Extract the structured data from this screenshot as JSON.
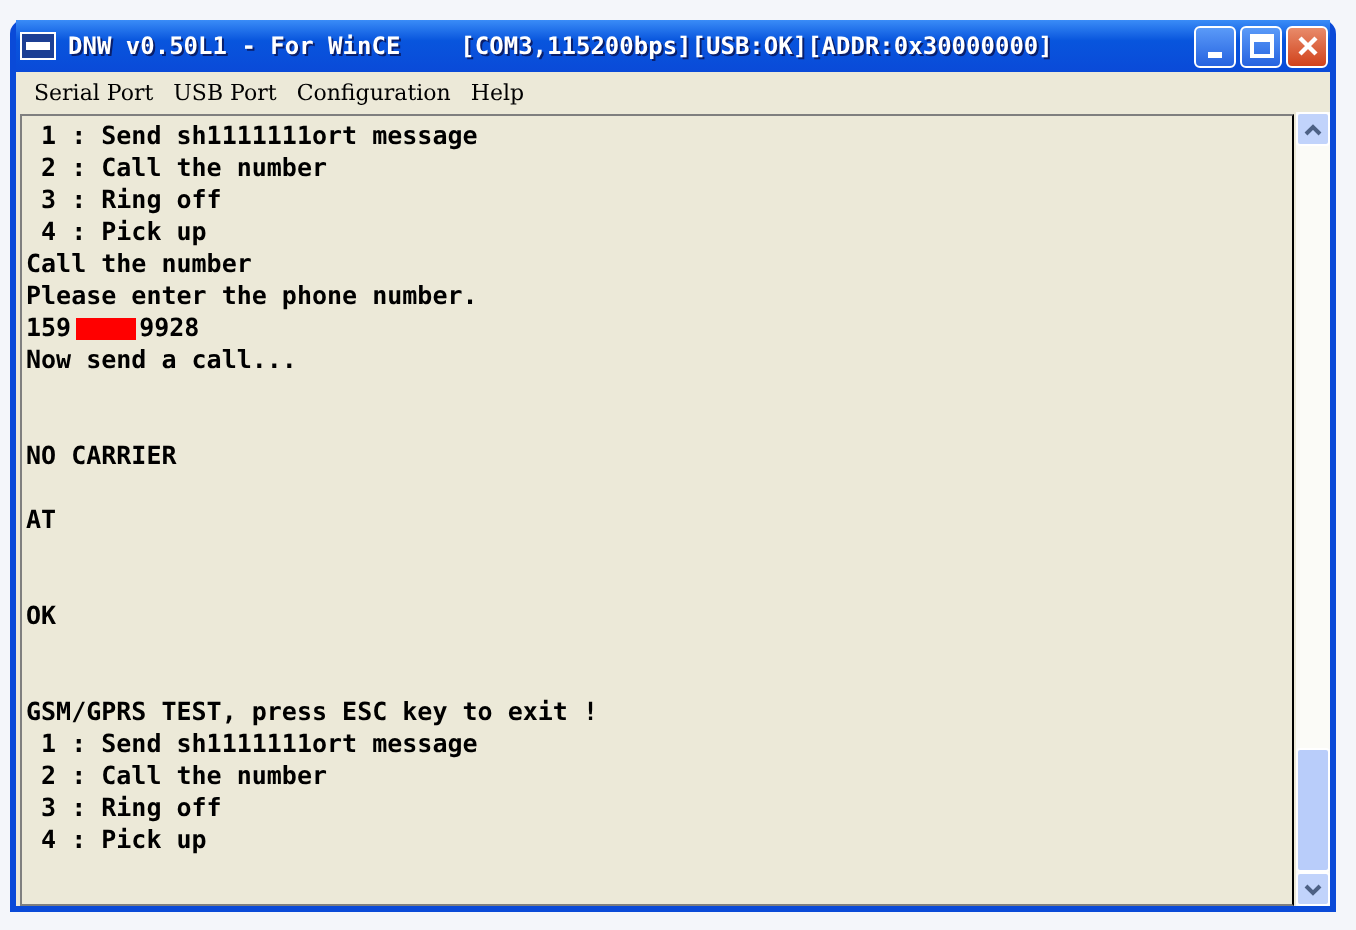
{
  "window": {
    "title": "DNW v0.50L1 - For WinCE",
    "status": "[COM3,115200bps][USB:OK][ADDR:0x30000000]"
  },
  "menu": [
    "Serial Port",
    "USB Port",
    "Configuration",
    "Help"
  ],
  "console": [
    {
      "kind": "text",
      "text": " 1 : Send sh1111111ort message"
    },
    {
      "kind": "text",
      "text": " 2 : Call the number"
    },
    {
      "kind": "text",
      "text": " 3 : Ring off"
    },
    {
      "kind": "text",
      "text": " 4 : Pick up"
    },
    {
      "kind": "text",
      "text": "Call the number"
    },
    {
      "kind": "text",
      "text": "Please enter the phone number."
    },
    {
      "kind": "redacted",
      "before": "159",
      "after": "9928"
    },
    {
      "kind": "text",
      "text": "Now send a call..."
    },
    {
      "kind": "blank"
    },
    {
      "kind": "blank"
    },
    {
      "kind": "text",
      "text": "NO CARRIER"
    },
    {
      "kind": "blank"
    },
    {
      "kind": "text",
      "text": "AT"
    },
    {
      "kind": "blank"
    },
    {
      "kind": "blank"
    },
    {
      "kind": "text",
      "text": "OK"
    },
    {
      "kind": "blank"
    },
    {
      "kind": "blank"
    },
    {
      "kind": "text",
      "text": "GSM/GPRS TEST, press ESC key to exit !"
    },
    {
      "kind": "text",
      "text": " 1 : Send sh1111111ort message"
    },
    {
      "kind": "text",
      "text": " 2 : Call the number"
    },
    {
      "kind": "text",
      "text": " 3 : Ring off"
    },
    {
      "kind": "text",
      "text": " 4 : Pick up"
    }
  ]
}
